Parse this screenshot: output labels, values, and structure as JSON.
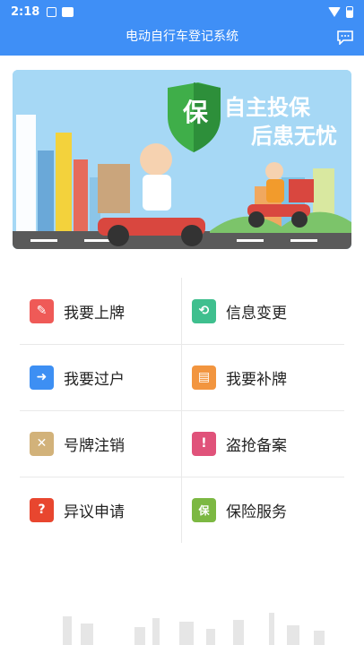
{
  "status": {
    "time": "2:18"
  },
  "appbar": {
    "title": "电动自行车登记系统",
    "message_icon": "chat-bubble-icon"
  },
  "banner": {
    "badge_char": "保",
    "headline_1": "自主投保",
    "headline_2": "后患无忧",
    "colors": {
      "sky": "#a6d8f5",
      "accent_green": "#3fae49",
      "scooter_red": "#d9473f"
    }
  },
  "menu": [
    {
      "label": "我要上牌",
      "icon": "pencil-icon",
      "color": "#ef5a57",
      "glyph": "✎"
    },
    {
      "label": "信息变更",
      "icon": "refresh-icon",
      "color": "#3fbf8e",
      "glyph": "⟲"
    },
    {
      "label": "我要过户",
      "icon": "arrow-right-icon",
      "color": "#3d8ff3",
      "glyph": "➜"
    },
    {
      "label": "我要补牌",
      "icon": "plate-icon",
      "color": "#f2953f",
      "glyph": "▤"
    },
    {
      "label": "号牌注销",
      "icon": "cross-icon",
      "color": "#d2b27a",
      "glyph": "✕"
    },
    {
      "label": "盗抢备案",
      "icon": "clipboard-icon",
      "color": "#e0527a",
      "glyph": "!"
    },
    {
      "label": "异议申请",
      "icon": "question-icon",
      "color": "#e8462f",
      "glyph": "?"
    },
    {
      "label": "保险服务",
      "icon": "shield-icon",
      "color": "#7cb842",
      "glyph": "保"
    }
  ]
}
